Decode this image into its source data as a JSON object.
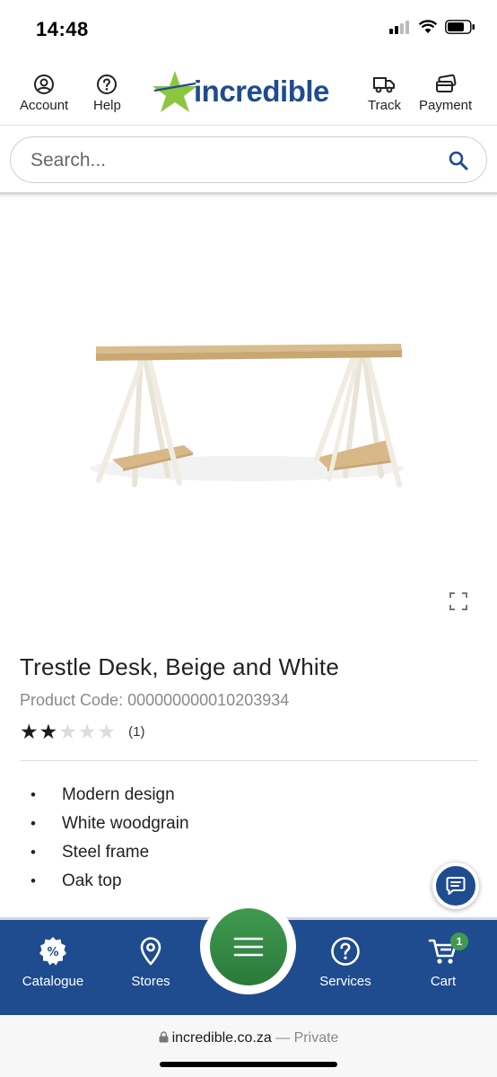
{
  "status_bar": {
    "time": "14:48"
  },
  "header": {
    "account_label": "Account",
    "help_label": "Help",
    "logo_text": "incredible",
    "track_label": "Track",
    "payment_label": "Payment"
  },
  "search": {
    "placeholder": "Search..."
  },
  "product": {
    "title": "Trestle Desk, Beige and White",
    "code": "Product Code: 000000000010203934",
    "rating_stars": 2,
    "rating_max": 5,
    "review_count": "(1)",
    "features": [
      "Modern design",
      "White woodgrain",
      "Steel frame",
      "Oak top"
    ]
  },
  "bottom_nav": {
    "catalogue_label": "Catalogue",
    "stores_label": "Stores",
    "services_label": "Services",
    "cart_label": "Cart",
    "cart_count": "1"
  },
  "browser": {
    "url": "incredible.co.za",
    "privacy": "— Private"
  },
  "colors": {
    "brand_blue": "#1f4c8f",
    "brand_green": "#3f9a4f",
    "logo_star": "#8cc63f"
  }
}
